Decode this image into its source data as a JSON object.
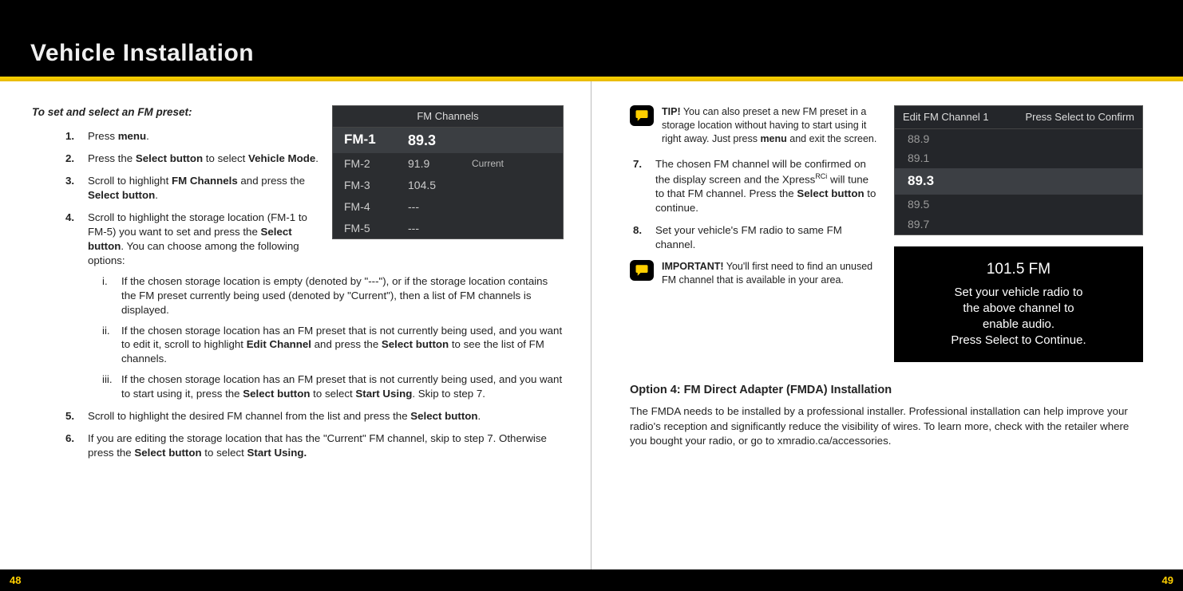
{
  "header": {
    "title": "Vehicle Installation"
  },
  "left": {
    "intro": "To set and select an FM preset:",
    "steps": {
      "s1": {
        "num": "1.",
        "a": "Press ",
        "b": "menu",
        "c": "."
      },
      "s2": {
        "num": "2.",
        "a": "Press the ",
        "b": "Select button",
        "c": " to select ",
        "d": "Vehicle Mode",
        "e": "."
      },
      "s3": {
        "num": "3.",
        "a": "Scroll to highlight ",
        "b": "FM Channels",
        "c": " and press the ",
        "d": "Select button",
        "e": "."
      },
      "s4": {
        "num": "4.",
        "a": "Scroll to highlight the storage location (FM-1 to FM-5) you want to set and press the ",
        "b": "Select button",
        "c": ". You can choose among the following options:",
        "i": {
          "rn": "i.",
          "a": "If the chosen storage location is empty (denoted by \"---\"), or if the storage location contains the FM preset currently being used (denoted by \"Current\"), then a list of FM channels is displayed."
        },
        "ii": {
          "rn": "ii.",
          "a": "If the chosen storage location has an FM preset that is not currently being used, and you want to edit it, scroll to highlight ",
          "b": "Edit Channel",
          "c": " and press the ",
          "d": "Select button",
          "e": " to see the list of FM channels."
        },
        "iii": {
          "rn": "iii.",
          "a": "If the chosen storage location has an FM preset that is not currently being used, and you want to start using it, press the ",
          "b": "Select button",
          "c": " to select ",
          "d": "Start Using",
          "e": ". Skip to step 7."
        }
      },
      "s5": {
        "num": "5.",
        "a": "Scroll to highlight the desired FM channel from the list and press the ",
        "b": "Select button",
        "c": "."
      },
      "s6": {
        "num": "6.",
        "a": "If you are editing the storage location that has the \"Current\" FM channel, skip to step 7. Otherwise press the ",
        "b": "Select button",
        "c": " to select ",
        "d": "Start Using."
      }
    },
    "fm_screenshot": {
      "title": "FM Channels",
      "rows": [
        {
          "label": "FM-1",
          "freq": "89.3",
          "tag": ""
        },
        {
          "label": "FM-2",
          "freq": "91.9",
          "tag": "Current"
        },
        {
          "label": "FM-3",
          "freq": "104.5",
          "tag": ""
        },
        {
          "label": "FM-4",
          "freq": "---",
          "tag": ""
        },
        {
          "label": "FM-5",
          "freq": "---",
          "tag": ""
        }
      ]
    }
  },
  "right": {
    "tip": {
      "bold": "TIP!",
      "text": " You can also preset a new FM preset in a storage location without having to start using it right away. Just press ",
      "b": "menu",
      "text2": " and exit the screen."
    },
    "s7": {
      "num": "7.",
      "a": "The chosen FM channel will be confirmed on the display screen and the Xpress",
      "sup": "RCi",
      "b": " will tune to that FM channel. Press the ",
      "c": "Select button",
      "d": " to continue."
    },
    "s8": {
      "num": "8.",
      "a": "Set your vehicle's FM radio to same FM channel."
    },
    "important": {
      "bold": "IMPORTANT!",
      "text": " You'll first need to find an unused FM channel that is available in your area."
    },
    "edit_screenshot": {
      "head_left": "Edit FM Channel 1",
      "head_right": "Press Select to Confirm",
      "rows": [
        "88.9",
        "89.1",
        "89.3",
        "89.5",
        "89.7"
      ]
    },
    "confirm_screenshot": {
      "big": "101.5 FM",
      "l1": "Set your vehicle radio to",
      "l2": "the above channel to",
      "l3": "enable audio.",
      "l4": "Press Select to Continue."
    },
    "option4": {
      "heading": "Option 4: FM Direct Adapter (FMDA) Installation",
      "body": "The FMDA needs to be installed by a professional installer. Professional installation can help improve your radio's reception and significantly reduce the visibility of wires. To learn more, check with the retailer where you bought your radio, or go to xmradio.ca/accessories."
    }
  },
  "footer": {
    "left": "48",
    "right": "49"
  }
}
